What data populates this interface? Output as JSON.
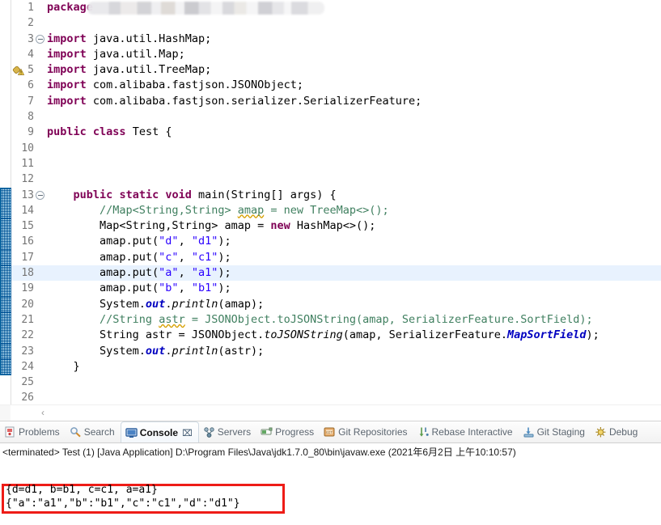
{
  "editor": {
    "name": "java-code-editor",
    "language": "Java",
    "current_line": 18,
    "changed_line_range": [
      13,
      24
    ],
    "warning_line": 5,
    "fold_lines": [
      3,
      13
    ],
    "hscroll_left_glyph": "‹",
    "redacted_package_name": "",
    "lines": [
      {
        "n": "1",
        "text": "package "
      },
      {
        "n": "2",
        "text": ""
      },
      {
        "n": "3",
        "text": "import java.util.HashMap;"
      },
      {
        "n": "4",
        "text": "import java.util.Map;"
      },
      {
        "n": "5",
        "text": "import java.util.TreeMap;"
      },
      {
        "n": "6",
        "text": "import com.alibaba.fastjson.JSONObject;"
      },
      {
        "n": "7",
        "text": "import com.alibaba.fastjson.serializer.SerializerFeature;"
      },
      {
        "n": "8",
        "text": ""
      },
      {
        "n": "9",
        "text": "public class Test {"
      },
      {
        "n": "10",
        "text": ""
      },
      {
        "n": "11",
        "text": ""
      },
      {
        "n": "12",
        "text": ""
      },
      {
        "n": "13",
        "text": "    public static void main(String[] args) {"
      },
      {
        "n": "14",
        "text": "        //Map<String,String> amap = new TreeMap<>();"
      },
      {
        "n": "15",
        "text": "        Map<String,String> amap = new HashMap<>();"
      },
      {
        "n": "16",
        "text": "        amap.put(\"d\", \"d1\");"
      },
      {
        "n": "17",
        "text": "        amap.put(\"c\", \"c1\");"
      },
      {
        "n": "18",
        "text": "        amap.put(\"a\", \"a1\");"
      },
      {
        "n": "19",
        "text": "        amap.put(\"b\", \"b1\");"
      },
      {
        "n": "20",
        "text": "        System.out.println(amap);"
      },
      {
        "n": "21",
        "text": "        //String astr = JSONObject.toJSONString(amap, SerializerFeature.SortField);"
      },
      {
        "n": "22",
        "text": "        String astr = JSONObject.toJSONString(amap, SerializerFeature.MapSortField);"
      },
      {
        "n": "23",
        "text": "        System.out.println(astr);"
      },
      {
        "n": "24",
        "text": "    }"
      },
      {
        "n": "25",
        "text": ""
      },
      {
        "n": "26",
        "text": ""
      }
    ]
  },
  "bottom_panel": {
    "tabs": [
      {
        "label": "Problems",
        "icon": "problems-icon",
        "active": false,
        "closable": false
      },
      {
        "label": "Search",
        "icon": "search-icon",
        "active": false,
        "closable": false
      },
      {
        "label": "Console",
        "icon": "console-icon",
        "active": true,
        "closable": true,
        "close_glyph": "⌧"
      },
      {
        "label": "Servers",
        "icon": "servers-icon",
        "active": false,
        "closable": false
      },
      {
        "label": "Progress",
        "icon": "progress-icon",
        "active": false,
        "closable": false
      },
      {
        "label": "Git Repositories",
        "icon": "git-repo-icon",
        "active": false,
        "closable": false
      },
      {
        "label": "Rebase Interactive",
        "icon": "rebase-icon",
        "active": false,
        "closable": false
      },
      {
        "label": "Git Staging",
        "icon": "git-staging-icon",
        "active": false,
        "closable": false
      },
      {
        "label": "Debug",
        "icon": "debug-icon",
        "active": false,
        "closable": false
      }
    ],
    "console": {
      "terminated_line": "<terminated> Test (1) [Java Application] D:\\Program Files\\Java\\jdk1.7.0_80\\bin\\javaw.exe (2021年6月2日 上午10:10:57)",
      "output_lines": [
        "{d=d1, b=b1, c=c1, a=a1}",
        "{\"a\":\"a1\",\"b\":\"b1\",\"c\":\"c1\",\"d\":\"d1\"}"
      ],
      "highlight_color": "#ee1c17"
    }
  },
  "colors": {
    "keyword": "#7f0055",
    "comment": "#3f7f5f",
    "string": "#2a00ff",
    "static_field": "#0000c0",
    "current_line_bg": "#e8f2fe",
    "change_bar": "#1d7fb8",
    "annotation_red": "#ee1c17"
  }
}
